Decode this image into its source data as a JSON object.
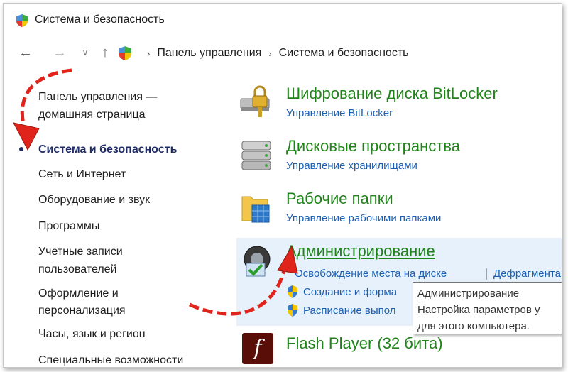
{
  "window": {
    "title": "Система и безопасность"
  },
  "navbar": {
    "back_glyph": "←",
    "forward_glyph": "→",
    "dropdown_glyph": "∨",
    "up_glyph": "↑",
    "breadcrumb": [
      "Панель управления",
      "Система и безопасность"
    ],
    "separator": "›"
  },
  "sidebar": {
    "items": [
      "Панель управления —",
      "домашняя страница",
      "Система и безопасность",
      "Сеть и Интернет",
      "Оборудование и звук",
      "Программы",
      "Учетные записи",
      "пользователей",
      "Оформление и",
      "персонализация",
      "Часы, язык и регион",
      "Специальные возможности"
    ]
  },
  "categories": {
    "bitlocker": {
      "title": "Шифрование диска BitLocker",
      "link": "Управление BitLocker",
      "icon": "lock-drive-icon"
    },
    "storage": {
      "title": "Дисковые пространства",
      "link": "Управление хранилищами",
      "icon": "storage-spaces-icon"
    },
    "workfolders": {
      "title": "Рабочие папки",
      "link": "Управление рабочими папками",
      "icon": "work-folders-icon"
    },
    "admin": {
      "title": "Администрирование",
      "link_free_space": "Освобождение места на диске",
      "link_defrag": "Дефрагмента",
      "link_create": "Создание и форма",
      "link_schedule": "Расписание выпол",
      "icon": "admin-tools-icon"
    },
    "flash": {
      "title": "Flash Player (32 бита)",
      "icon": "flash-icon",
      "glyph": "f"
    }
  },
  "tooltip": {
    "title": "Администрирование",
    "line1": "Настройка параметров у",
    "line2": "для этого компьютера."
  },
  "colors": {
    "category_green": "#1f8418",
    "link_blue": "#1a5fb4",
    "arrow_red": "#e0241b",
    "highlight_bg": "#e6f1fb"
  }
}
